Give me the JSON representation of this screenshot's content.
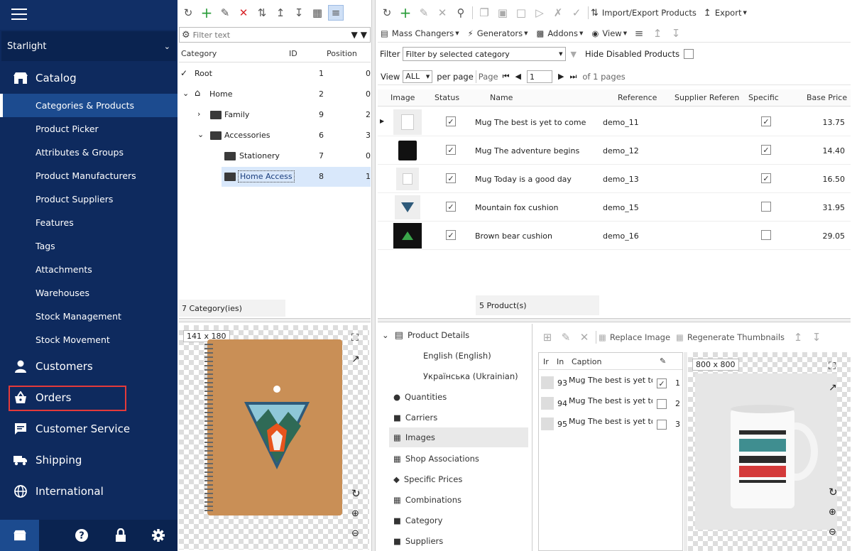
{
  "sidebar": {
    "store": "Starlight",
    "catalog": "Catalog",
    "catalog_items": [
      "Categories & Products",
      "Product Picker",
      "Attributes & Groups",
      "Product Manufacturers",
      "Product Suppliers",
      "Features",
      "Tags",
      "Attachments",
      "Warehouses",
      "Stock Management",
      "Stock Movement"
    ],
    "customers": "Customers",
    "orders": "Orders",
    "customer_service": "Customer Service",
    "shipping": "Shipping",
    "international": "International"
  },
  "category_panel": {
    "filter_placeholder": "Filter text",
    "col_category": "Category",
    "col_id": "ID",
    "col_position": "Position",
    "rows": [
      {
        "name": "Root",
        "id": "1",
        "pos": "0"
      },
      {
        "name": "Home",
        "id": "2",
        "pos": "0"
      },
      {
        "name": "Family",
        "id": "9",
        "pos": "2"
      },
      {
        "name": "Accessories",
        "id": "6",
        "pos": "3"
      },
      {
        "name": "Stationery",
        "id": "7",
        "pos": "0"
      },
      {
        "name": "Home Access",
        "id": "8",
        "pos": "1"
      }
    ],
    "footer": "7 Category(ies)",
    "image_size": "141 x 180"
  },
  "products": {
    "toolbar": {
      "import_export": "Import/Export Products",
      "export": "Export",
      "mass_changers": "Mass Changers",
      "generators": "Generators",
      "addons": "Addons",
      "view": "View"
    },
    "filter_label": "Filter",
    "filter_value": "Filter by selected category",
    "hide_disabled": "Hide Disabled Products",
    "view_label": "View",
    "view_value": "ALL",
    "per_page": "per page",
    "page_label": "Page",
    "page_value": "1",
    "of_pages": "of 1 pages",
    "columns": {
      "image": "Image",
      "status": "Status",
      "name": "Name",
      "reference": "Reference",
      "supplier_reference": "Supplier Referenc",
      "specific": "Specific",
      "base_price": "Base Price"
    },
    "rows": [
      {
        "name": "Mug The best is yet to come",
        "reference": "demo_11",
        "specific": true,
        "price": "13.75"
      },
      {
        "name": "Mug The adventure begins",
        "reference": "demo_12",
        "specific": true,
        "price": "14.40"
      },
      {
        "name": "Mug Today is a good day",
        "reference": "demo_13",
        "specific": true,
        "price": "16.50"
      },
      {
        "name": "Mountain fox cushion",
        "reference": "demo_15",
        "specific": false,
        "price": "31.95"
      },
      {
        "name": "Brown bear cushion",
        "reference": "demo_16",
        "specific": false,
        "price": "29.05"
      }
    ],
    "footer": "5 Product(s)"
  },
  "details": {
    "items": [
      "Product Details",
      "English (English)",
      "Українська (Ukrainian)",
      "Quantities",
      "Carriers",
      "Images",
      "Shop Associations",
      "Specific Prices",
      "Combinations",
      "Category",
      "Suppliers"
    ]
  },
  "images_panel": {
    "replace": "Replace Image",
    "regenerate": "Regenerate Thumbnails",
    "col_i": "Ir",
    "col_in": "In",
    "col_caption": "Caption",
    "rows": [
      {
        "id": "93",
        "caption": "Mug The best is yet to",
        "checked": true,
        "pos": "1"
      },
      {
        "id": "94",
        "caption": "Mug The best is yet to",
        "checked": false,
        "pos": "2"
      },
      {
        "id": "95",
        "caption": "Mug The best is yet to",
        "checked": false,
        "pos": "3"
      }
    ],
    "image_size": "800 x 800"
  },
  "colors": {
    "sidebar": "#0e2a5e",
    "active": "#1c4b8f",
    "highlight": "#e43a3a",
    "selection": "#d9e8fb"
  }
}
